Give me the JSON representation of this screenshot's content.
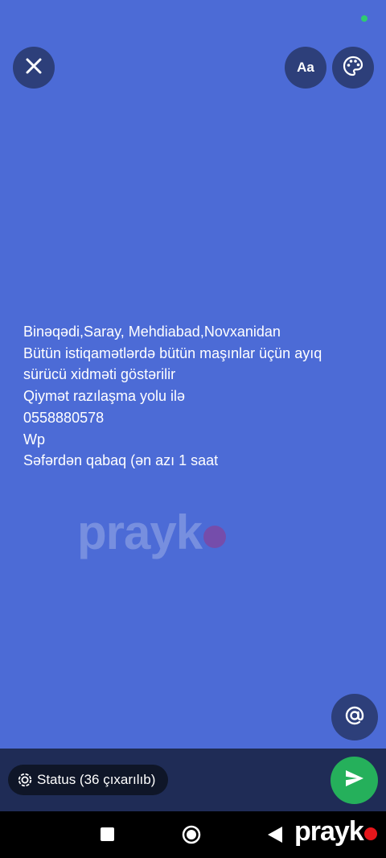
{
  "editor": {
    "font_button_label": "Aa",
    "status_lines": [
      "Binəqədi,Saray, Mehdiabad,Novxanidan",
      "Bütün istiqamətlərdə bütün maşınlar üçün ayıq",
      "sürücü xidməti göstərilir",
      "Qiymət razılaşma yolu ilə",
      "0558880578",
      "Wp",
      "Səfərdən qabaq (ən azı 1 saat"
    ],
    "background_color": "#4c6bd6"
  },
  "watermark": {
    "text": "prayk"
  },
  "composer": {
    "status_chip_label": "Status (36 çıxarılıb)",
    "send_color": "#25b05b"
  },
  "brand": {
    "text": "prayk"
  },
  "icons": {
    "close": "close-icon",
    "palette": "palette-icon",
    "mention": "at-sign-icon",
    "status": "status-ring-icon",
    "send": "send-icon",
    "nav_recents": "square-icon",
    "nav_home": "circle-icon",
    "nav_back": "triangle-back-icon"
  }
}
